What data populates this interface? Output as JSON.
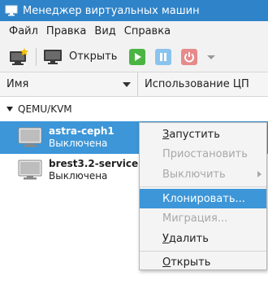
{
  "window": {
    "title": "Менеджер виртуальных машин"
  },
  "menubar": {
    "items": [
      "Файл",
      "Правка",
      "Вид",
      "Справка"
    ]
  },
  "toolbar": {
    "open_label": "Открыть"
  },
  "columns": {
    "name": "Имя",
    "cpu": "Использование ЦП"
  },
  "group": {
    "label": "QEMU/KVM"
  },
  "vms": [
    {
      "name": "astra-ceph1",
      "state": "Выключена"
    },
    {
      "name": "brest3.2-service",
      "state": "Выключена"
    }
  ],
  "context_menu": {
    "run": {
      "first": "З",
      "rest": "апустить"
    },
    "pause": "Приостановить",
    "shutdown": "Выключить",
    "clone": "Клонировать...",
    "migrate": "Миграция...",
    "delete": {
      "first": "У",
      "rest": "далить"
    },
    "open": {
      "first": "О",
      "rest": "ткрыть"
    }
  },
  "colors": {
    "accent": "#3c96d8",
    "titlebar": "#2f83c8",
    "run_green": "#4bb543",
    "pause_blue": "#8ac4ee",
    "stop_red": "#e68a8a"
  }
}
